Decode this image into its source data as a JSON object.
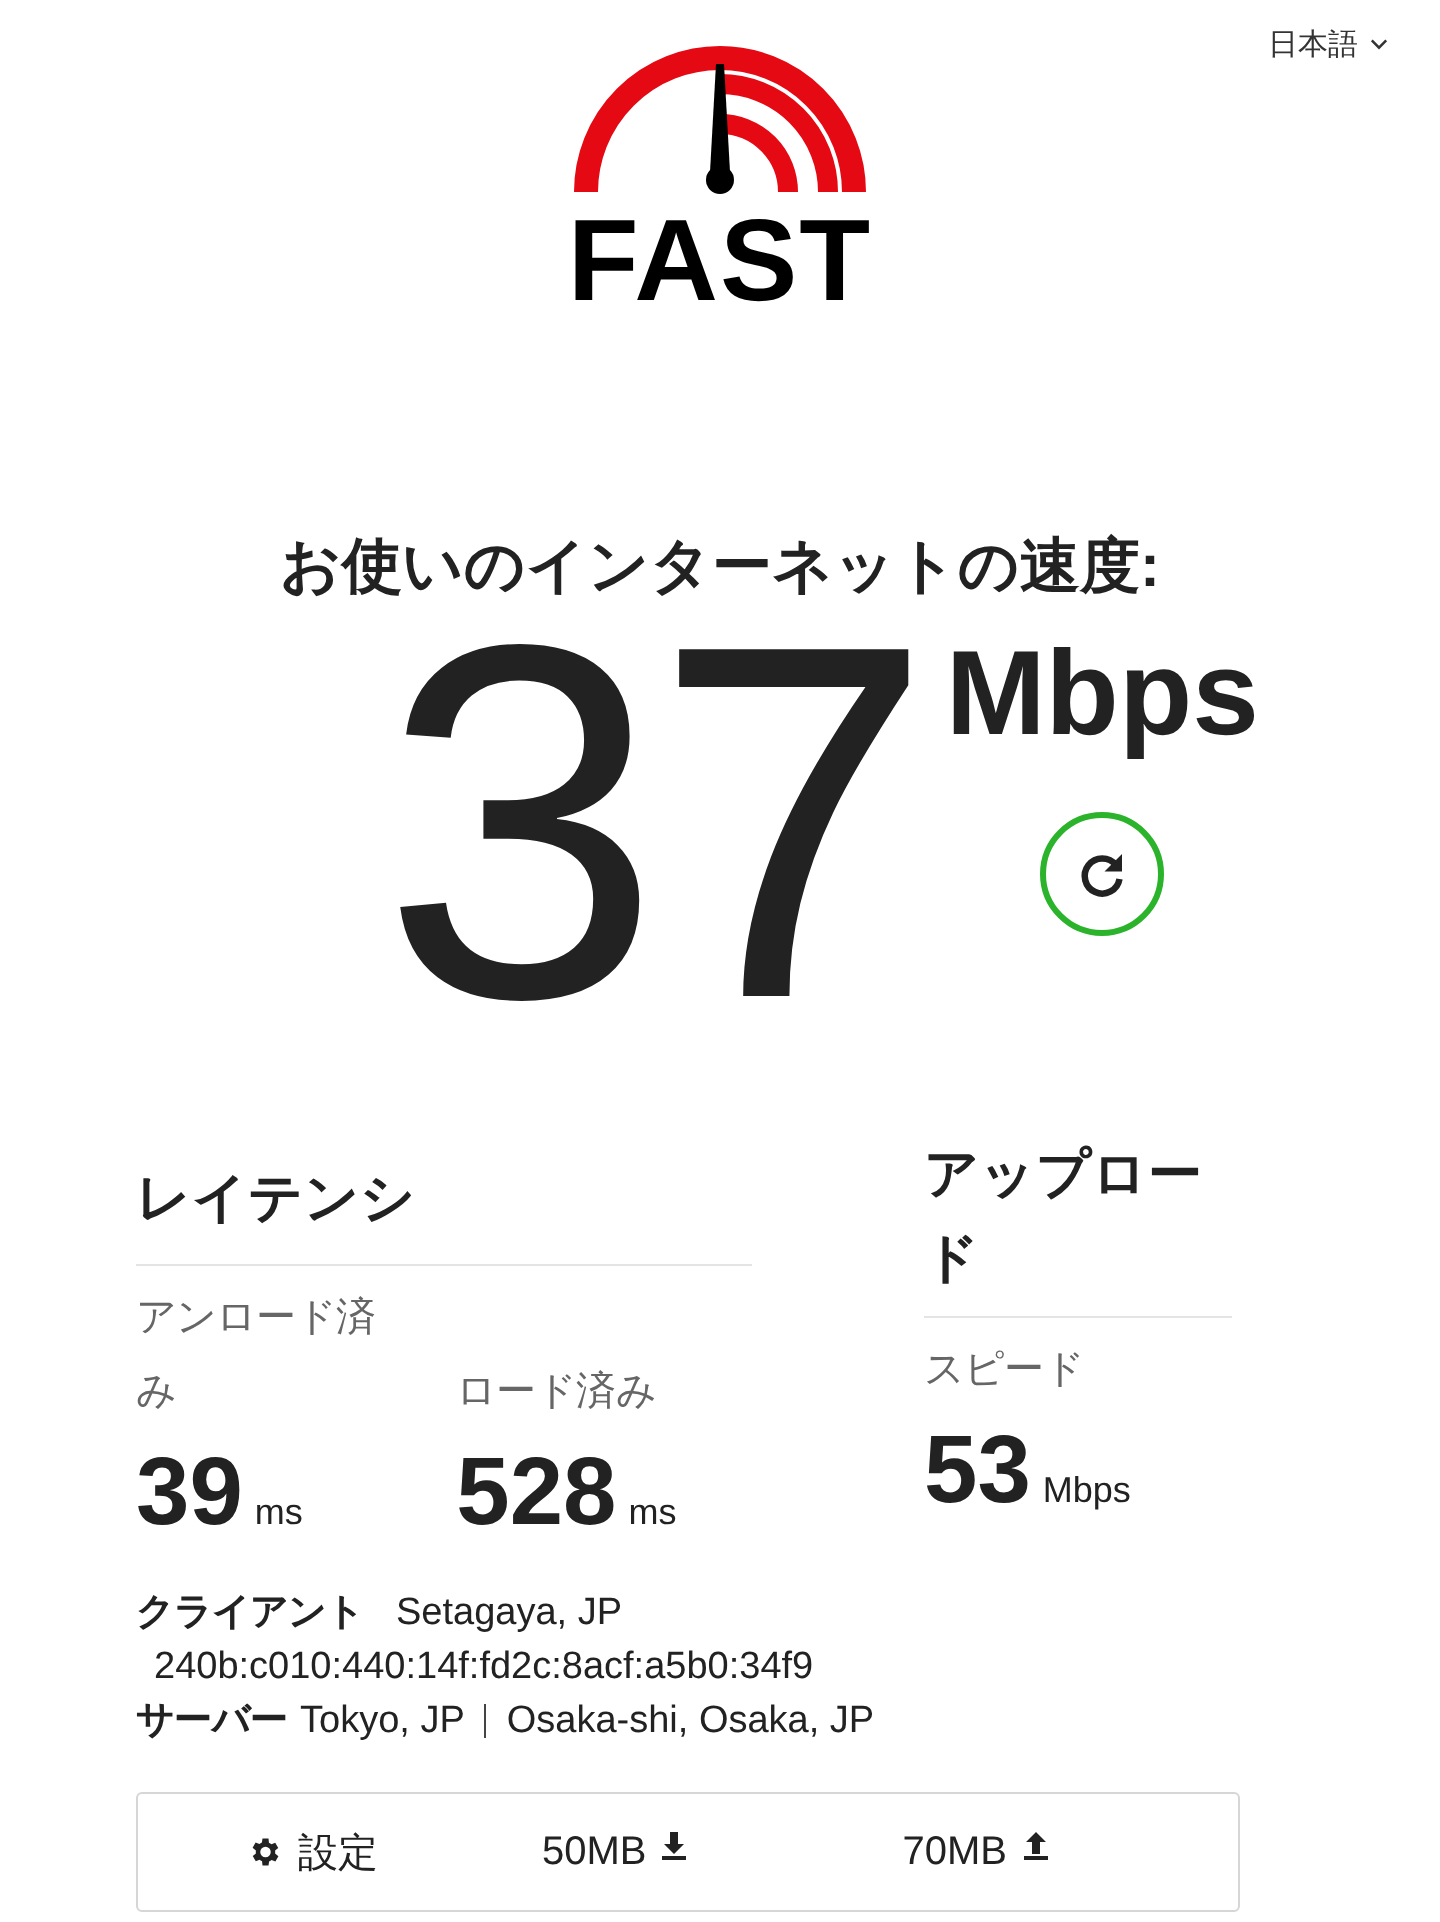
{
  "language": {
    "label": "日本語"
  },
  "logo": {
    "text": "FAST"
  },
  "speed": {
    "heading": "お使いのインターネットの速度:",
    "value": "37",
    "unit": "Mbps"
  },
  "latency": {
    "title": "レイテンシ",
    "items": [
      {
        "label": "アンロード済み",
        "value": "39",
        "unit": "ms"
      },
      {
        "label": "ロード済み",
        "value": "528",
        "unit": "ms"
      }
    ]
  },
  "upload": {
    "title": "アップロード",
    "items": [
      {
        "label": "スピード",
        "value": "53",
        "unit": "Mbps"
      }
    ]
  },
  "client": {
    "label": "クライアント",
    "location": "Setagaya, JP",
    "ip": "240b:c010:440:14f:fd2c:8acf:a5b0:34f9"
  },
  "server": {
    "label": "サーバー",
    "locations": [
      "Tokyo, JP",
      "Osaka-shi, Osaka, JP"
    ]
  },
  "settings": {
    "label": "設定",
    "download": "50MB",
    "upload": "70MB"
  }
}
